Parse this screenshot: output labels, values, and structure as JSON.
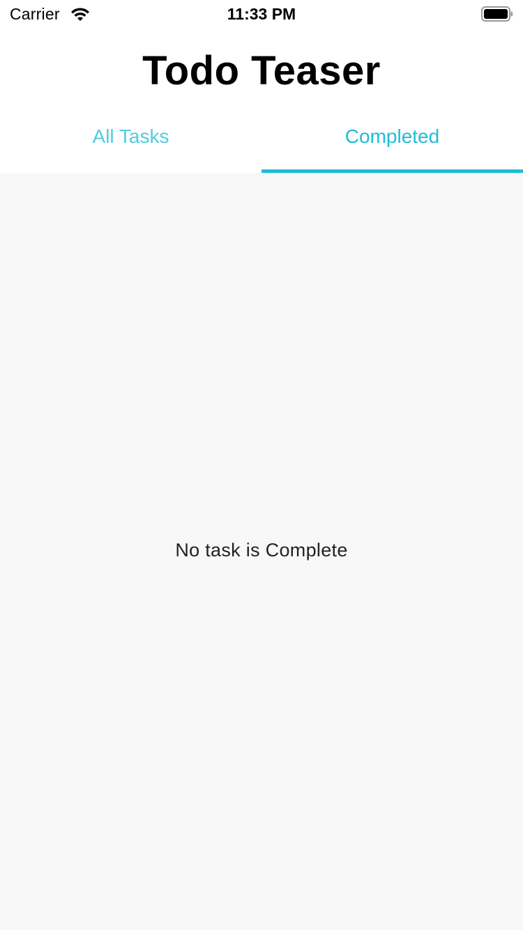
{
  "status_bar": {
    "carrier": "Carrier",
    "time": "11:33 PM",
    "wifi_icon": "wifi-icon",
    "battery_icon": "battery-icon"
  },
  "header": {
    "title": "Todo Teaser"
  },
  "tabs": [
    {
      "label": "All Tasks",
      "selected": false
    },
    {
      "label": "Completed",
      "selected": true
    }
  ],
  "content": {
    "empty_message": "No task is Complete"
  },
  "colors": {
    "accent": "#1fbdd4",
    "accent_light": "#4fcde0",
    "background": "#f8f8f8",
    "header_background": "#ffffff"
  }
}
